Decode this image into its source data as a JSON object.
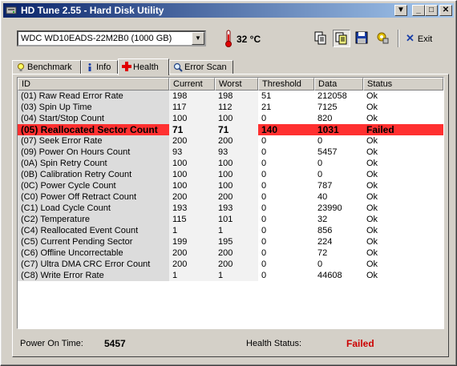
{
  "window": {
    "title": "HD Tune 2.55 - Hard Disk Utility"
  },
  "title_buttons": {
    "menu": "▼",
    "minimize": "_",
    "maximize": "□",
    "close": "✕"
  },
  "toolbar": {
    "drive": "WDC WD10EADS-22M2B0 (1000 GB)",
    "temperature": "32 °C",
    "exit_label": "Exit"
  },
  "tabs": [
    {
      "label": "Benchmark",
      "icon": "lightbulb-icon"
    },
    {
      "label": "Info",
      "icon": "info-icon"
    },
    {
      "label": "Health",
      "icon": "red-cross-icon",
      "active": true
    },
    {
      "label": "Error Scan",
      "icon": "magnifier-icon"
    }
  ],
  "columns": [
    "ID",
    "Current",
    "Worst",
    "Threshold",
    "Data",
    "Status"
  ],
  "rows": [
    {
      "id": "(01) Raw Read Error Rate",
      "current": "198",
      "worst": "198",
      "threshold": "51",
      "data": "212058",
      "status": "Ok"
    },
    {
      "id": "(03) Spin Up Time",
      "current": "117",
      "worst": "112",
      "threshold": "21",
      "data": "7125",
      "status": "Ok"
    },
    {
      "id": "(04) Start/Stop Count",
      "current": "100",
      "worst": "100",
      "threshold": "0",
      "data": "820",
      "status": "Ok"
    },
    {
      "id": "(05) Reallocated Sector Count",
      "current": "71",
      "worst": "71",
      "threshold": "140",
      "data": "1031",
      "status": "Failed",
      "failed": true
    },
    {
      "id": "(07) Seek Error Rate",
      "current": "200",
      "worst": "200",
      "threshold": "0",
      "data": "0",
      "status": "Ok"
    },
    {
      "id": "(09) Power On Hours Count",
      "current": "93",
      "worst": "93",
      "threshold": "0",
      "data": "5457",
      "status": "Ok"
    },
    {
      "id": "(0A) Spin Retry Count",
      "current": "100",
      "worst": "100",
      "threshold": "0",
      "data": "0",
      "status": "Ok"
    },
    {
      "id": "(0B) Calibration Retry Count",
      "current": "100",
      "worst": "100",
      "threshold": "0",
      "data": "0",
      "status": "Ok"
    },
    {
      "id": "(0C) Power Cycle Count",
      "current": "100",
      "worst": "100",
      "threshold": "0",
      "data": "787",
      "status": "Ok"
    },
    {
      "id": "(C0) Power Off Retract Count",
      "current": "200",
      "worst": "200",
      "threshold": "0",
      "data": "40",
      "status": "Ok"
    },
    {
      "id": "(C1) Load Cycle Count",
      "current": "193",
      "worst": "193",
      "threshold": "0",
      "data": "23990",
      "status": "Ok"
    },
    {
      "id": "(C2) Temperature",
      "current": "115",
      "worst": "101",
      "threshold": "0",
      "data": "32",
      "status": "Ok"
    },
    {
      "id": "(C4) Reallocated Event Count",
      "current": "1",
      "worst": "1",
      "threshold": "0",
      "data": "856",
      "status": "Ok"
    },
    {
      "id": "(C5) Current Pending Sector",
      "current": "199",
      "worst": "195",
      "threshold": "0",
      "data": "224",
      "status": "Ok"
    },
    {
      "id": "(C6) Offline Uncorrectable",
      "current": "200",
      "worst": "200",
      "threshold": "0",
      "data": "72",
      "status": "Ok"
    },
    {
      "id": "(C7) Ultra DMA CRC Error Count",
      "current": "200",
      "worst": "200",
      "threshold": "0",
      "data": "0",
      "status": "Ok"
    },
    {
      "id": "(C8) Write Error Rate",
      "current": "1",
      "worst": "1",
      "threshold": "0",
      "data": "44608",
      "status": "Ok"
    }
  ],
  "footer": {
    "power_on_label": "Power On Time:",
    "power_on_value": "5457",
    "health_label": "Health Status:",
    "health_value": "Failed"
  },
  "colors": {
    "failed_row": "#ff3030",
    "failed_text": "#cc0000",
    "title_gradient_start": "#0a246a",
    "title_gradient_end": "#a6caf0"
  }
}
